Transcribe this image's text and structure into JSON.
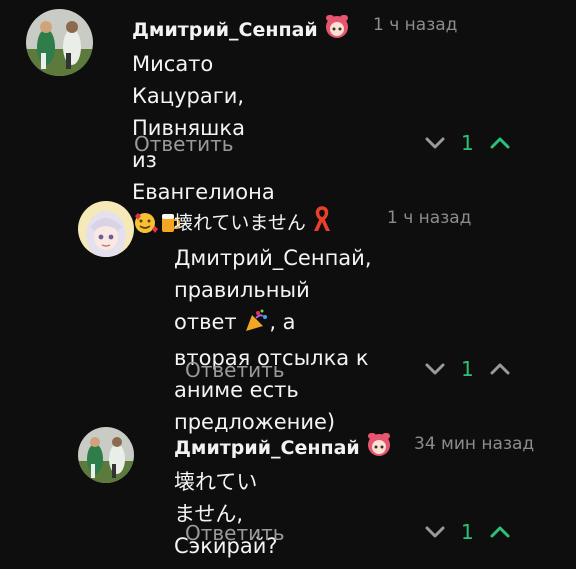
{
  "comments": [
    {
      "author": "Дмитрий_Сенпай",
      "time": "1 ч назад",
      "text_line1": "Мисато Кацураги, Пивняшка из",
      "text_line2": "Евангелиона",
      "reply_label": "Ответить",
      "score": "1",
      "score_color": "#2ec07a"
    },
    {
      "author": "壊れていません",
      "time": "1 ч назад",
      "text_line1": "Дмитрий_Сенпай, правильный",
      "text_line2a": "ответ",
      "text_line2b": ", а вторая отсылка к",
      "text_line3": "аниме есть предложение)",
      "reply_label": "Ответить",
      "score": "1",
      "score_color": "#2ec07a"
    },
    {
      "author": "Дмитрий_Сенпай",
      "time": "34 мин назад",
      "text_line1": "壊れていません, Сэкирай?",
      "reply_label": "Ответить",
      "score": "1",
      "score_color": "#2ec07a"
    }
  ],
  "colors": {
    "background": "#0e0e0e",
    "upvote_active": "#2ec07a",
    "downvote": "#9a9a9a",
    "muted": "#8c8c8c"
  },
  "icons": {
    "badge_1": "anime-girl-badge-icon",
    "badge_2": "red-ribbon-icon",
    "emoji_1": "smiling-face-with-hearts-icon",
    "emoji_2": "beer-mug-icon",
    "emoji_3": "party-popper-icon"
  }
}
